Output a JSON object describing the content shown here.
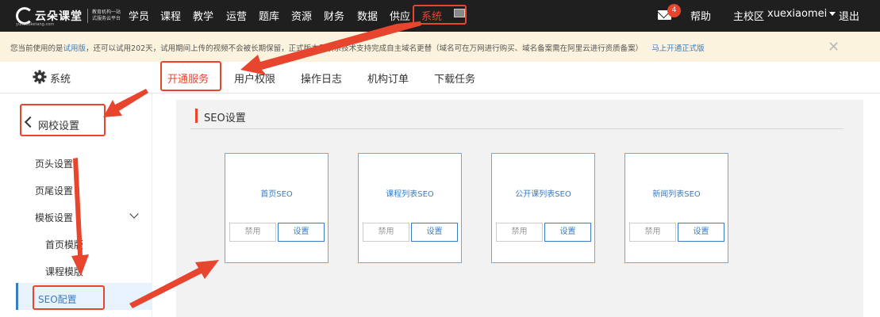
{
  "brand": {
    "name": "云朵课堂",
    "domain_text": "yunduoketang.com",
    "slogan": "教育机构一站式服务云平台"
  },
  "nav": {
    "items": [
      "学员",
      "课程",
      "教学",
      "运营",
      "题库",
      "资源",
      "财务",
      "数据",
      "供应",
      "系统"
    ],
    "mail_badge": "4",
    "help": "帮助",
    "campus": "主校区",
    "user": "xuexiaomei",
    "logout": "退出"
  },
  "notice": {
    "prefix": "您当前使用的是",
    "version": "试用版",
    "body": "，还可以试用202天，试用期间上传的视频不会被长期保留，正式版本需联系技术支持完成自主域名更替（域名可在万网进行购买、域名备案需在阿里云进行资质备案）",
    "link": "马上开通正式版",
    "close": "✕"
  },
  "subheader": {
    "title": "系统",
    "tabs": [
      "开通服务",
      "用户权限",
      "操作日志",
      "机构订单",
      "下载任务"
    ],
    "active_tab": "开通服务"
  },
  "sidebar": {
    "back_label": "网校设置",
    "items": [
      "页头设置",
      "页尾设置",
      "模板设置",
      "首页模版",
      "课程模版",
      "SEO配置"
    ],
    "active": "SEO配置"
  },
  "content": {
    "section_title": "SEO设置",
    "cards": [
      {
        "title": "首页SEO",
        "disable": "禁用",
        "set": "设置"
      },
      {
        "title": "课程列表SEO",
        "disable": "禁用",
        "set": "设置"
      },
      {
        "title": "公开课列表SEO",
        "disable": "禁用",
        "set": "设置"
      },
      {
        "title": "新闻列表SEO",
        "disable": "禁用",
        "set": "设置"
      }
    ]
  },
  "colors": {
    "accent": "#e8452f",
    "link": "#3a7cc4",
    "topbar": "#1f1f1f",
    "notice_bg": "#fbf3dd"
  }
}
